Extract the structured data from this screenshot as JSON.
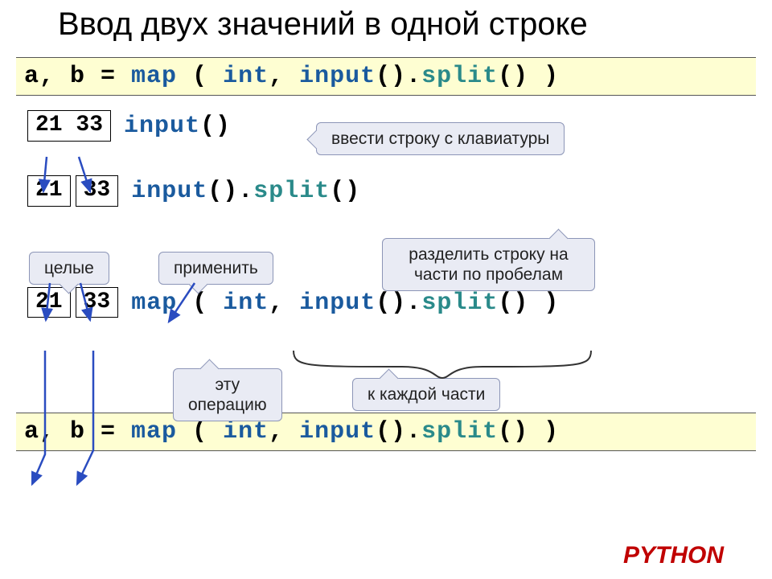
{
  "title": "Ввод двух значений в одной строке",
  "code_top": {
    "p1": "a, b = ",
    "p2": "map",
    "p3": " ( ",
    "p4": "int",
    "p5": ", ",
    "p6": "input",
    "p7": "().",
    "p8": "split",
    "p9": "() )"
  },
  "row1": {
    "box": "21 33",
    "code_p1": "input",
    "code_p2": "()"
  },
  "row2": {
    "boxA": "21",
    "boxB": "33",
    "code_p1": "input",
    "code_p2": "().",
    "code_p3": "split",
    "code_p4": "()"
  },
  "row3": {
    "boxA": "21",
    "boxB": "33",
    "code_p1": "map",
    "code_p2": " ( ",
    "code_p3": "int",
    "code_p4": ", ",
    "code_p5": "input",
    "code_p6": "().",
    "code_p7": "split",
    "code_p8": "() )"
  },
  "code_bottom": {
    "p1": "a, b = ",
    "p2": "map",
    "p3": " ( ",
    "p4": "int",
    "p5": ", ",
    "p6": "input",
    "p7": "().",
    "p8": "split",
    "p9": "() )"
  },
  "callouts": {
    "keyboard": "ввести строку с клавиатуры",
    "split": "разделить строку на\nчасти по пробелам",
    "integers": "целые",
    "apply": "применить",
    "this_op": "эту\nоперацию",
    "each_part": "к каждой части"
  },
  "python": "PYTHON"
}
